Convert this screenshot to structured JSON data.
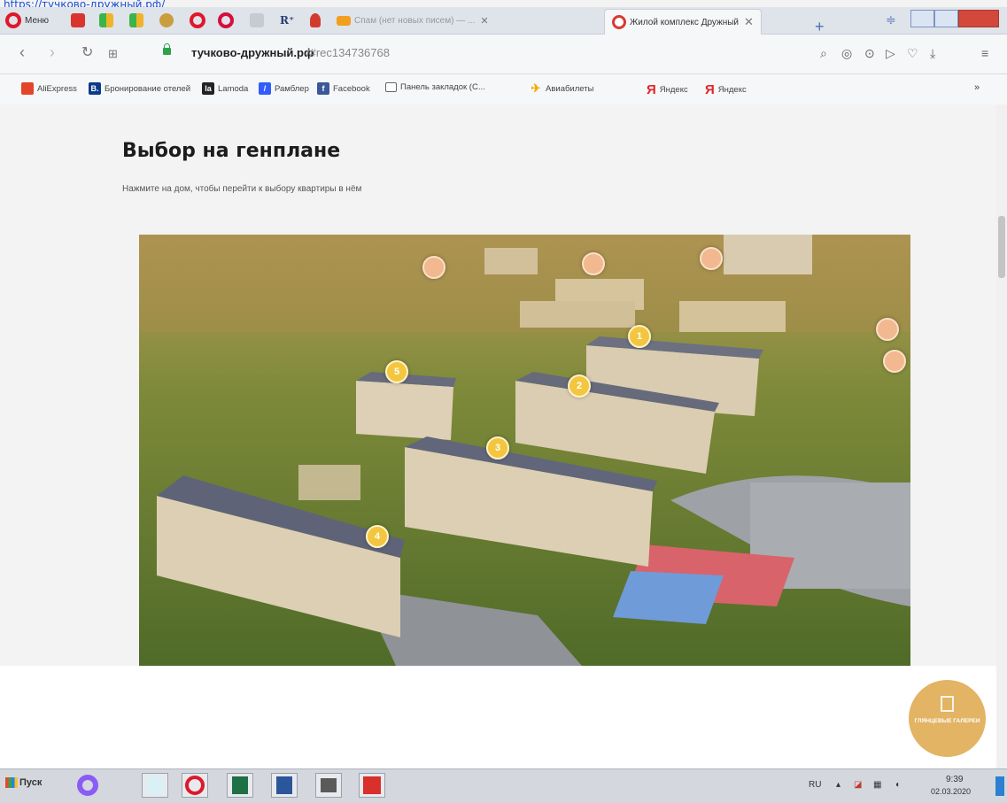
{
  "top_link": "https://тучково-дружный.рф/",
  "tabs": [
    {
      "label": "Меню",
      "icon": "opera-menu-icon"
    },
    {
      "label": "",
      "icon": "pdf-icon"
    },
    {
      "label": "",
      "icon": "app-grid-icon"
    },
    {
      "label": "",
      "icon": "app-grid-icon"
    },
    {
      "label": "",
      "icon": "cake-icon"
    },
    {
      "label": "",
      "icon": "opera-icon"
    },
    {
      "label": "",
      "icon": "opera-icon"
    },
    {
      "label": "",
      "icon": "list-icon"
    },
    {
      "label": "",
      "icon": "r-icon"
    },
    {
      "label": "",
      "icon": "person-icon"
    },
    {
      "label": "Спам (нет новых писем) — ...",
      "icon": "mail-icon"
    },
    {
      "label": "Жилой комплекс Дружный",
      "icon": "site-icon",
      "active": true
    }
  ],
  "address": {
    "host": "тучково-дружный.рф",
    "path": "/#rec134736768"
  },
  "bookmarks": [
    {
      "label": "AliExpress",
      "icon": "aliexpress-icon",
      "color": "#e2452b"
    },
    {
      "label": "Бронирование отелей",
      "icon": "booking-icon",
      "color": "#0b3b8a",
      "letter": "B."
    },
    {
      "label": "Lamoda",
      "icon": "lamoda-icon",
      "color": "#222222",
      "letter": "la"
    },
    {
      "label": "Рамблер",
      "icon": "rambler-icon",
      "color": "#315efb",
      "letter": "/"
    },
    {
      "label": "Facebook",
      "icon": "facebook-icon",
      "color": "#3b5998",
      "letter": "f"
    },
    {
      "label": "Панель закладок (С...",
      "icon": "folder-icon",
      "color": "#ffffff"
    },
    {
      "label": "Авиабилеты",
      "icon": "plane-icon",
      "color": "#f2a900"
    },
    {
      "label": "Яндекс",
      "icon": "yandex-icon",
      "color": "#e0252b"
    },
    {
      "label": "Яндекс",
      "icon": "yandex-icon",
      "color": "#e0252b"
    }
  ],
  "page": {
    "title": "Выбор на генплане",
    "subtitle": "Нажмите на дом, чтобы перейти к выбору квартиры в нём"
  },
  "markers": [
    {
      "label": "1"
    },
    {
      "label": "2"
    },
    {
      "label": "3"
    },
    {
      "label": "4"
    },
    {
      "label": "5"
    },
    {
      "label": ""
    },
    {
      "label": ""
    },
    {
      "label": ""
    },
    {
      "label": ""
    },
    {
      "label": ""
    }
  ],
  "fab": {
    "label": "ГЛЯНЦЕВЫЕ ГАЛЕРЕИ",
    "color": "#e2b463"
  },
  "taskbar": {
    "start_label": "Пуск",
    "lang": "RU",
    "time": "9:39",
    "date": "02.03.2020"
  }
}
